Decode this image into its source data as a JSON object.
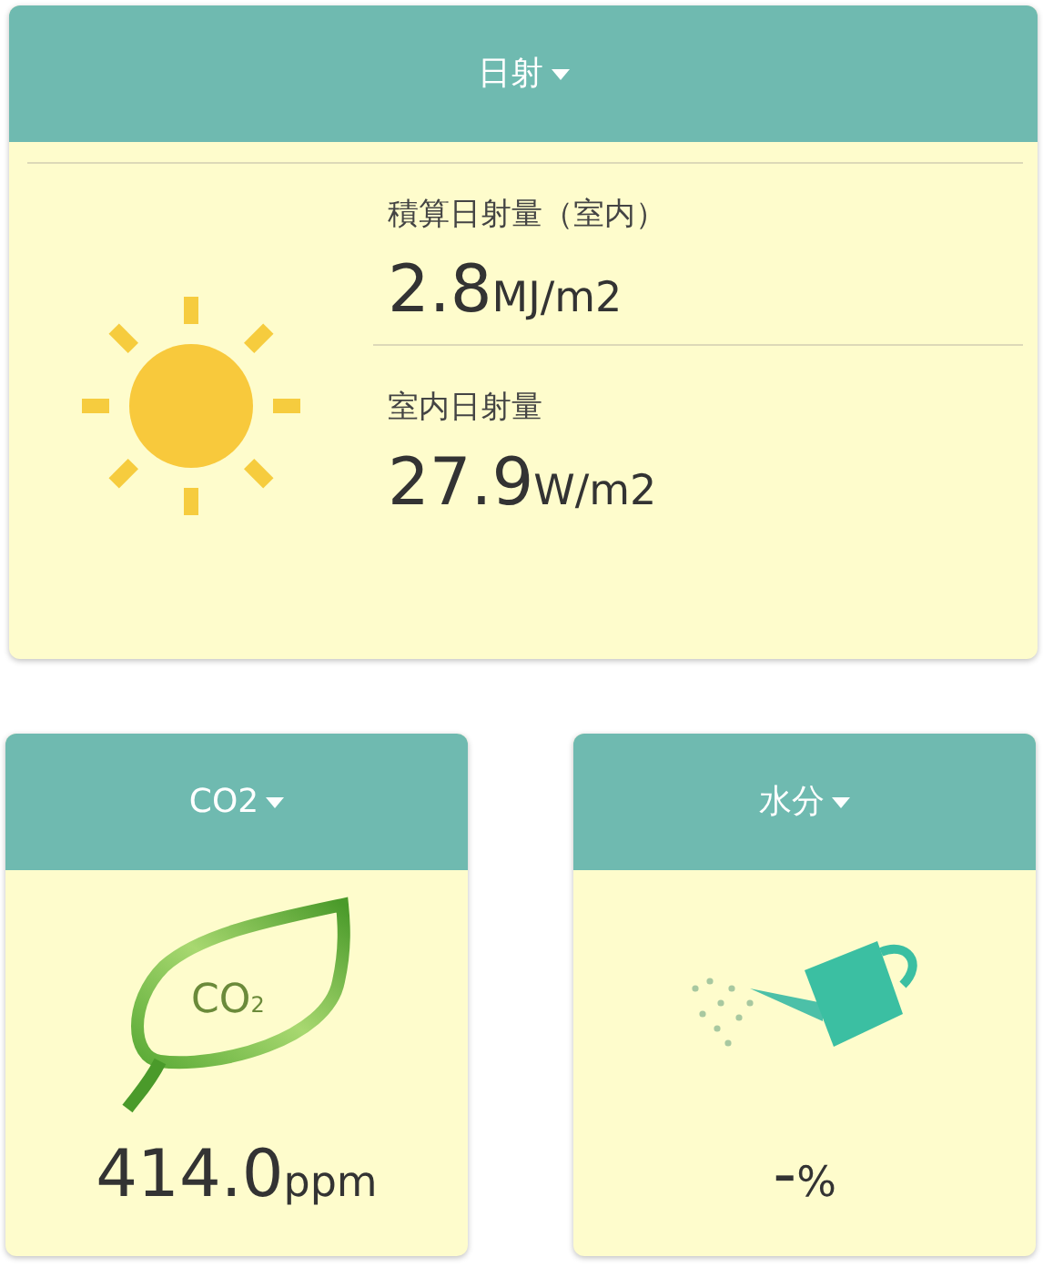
{
  "panels": [
    {
      "kind": "solar",
      "title": "日射",
      "readings": [
        {
          "label": "積算日射量（室内）",
          "value": "2.8",
          "unit": "MJ/m2"
        },
        {
          "label": "室内日射量",
          "value": "27.9",
          "unit": "W/m2"
        }
      ]
    },
    {
      "kind": "co2",
      "title": "CO2",
      "icon_text": "CO$_{2}$",
      "value": "414.0",
      "unit": "ppm"
    },
    {
      "kind": "moisture",
      "title": "水分",
      "value": "-",
      "unit": "%"
    }
  ]
}
